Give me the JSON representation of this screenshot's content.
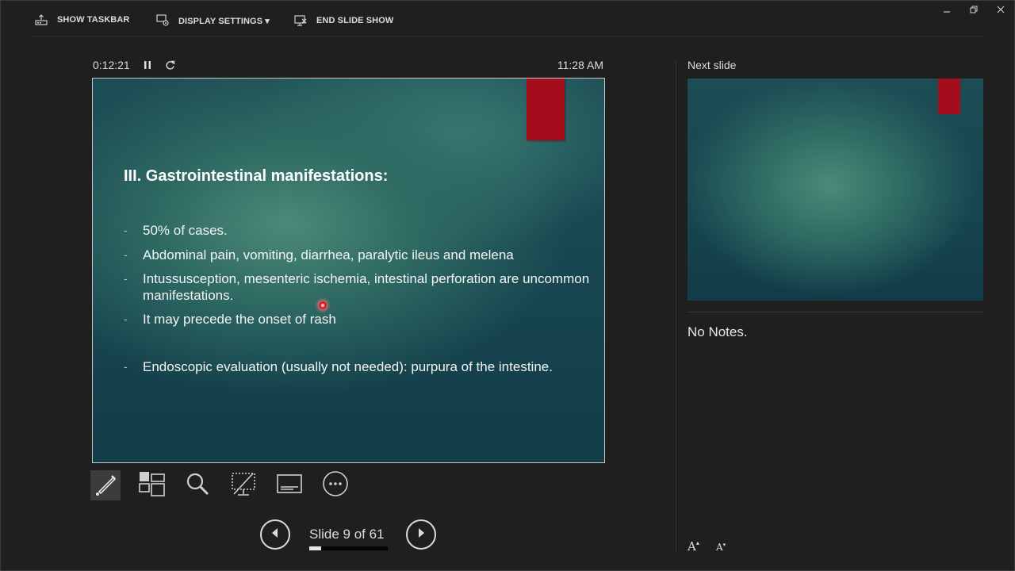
{
  "toolbar": {
    "show_taskbar": "SHOW TASKBAR",
    "display_settings": "DISPLAY SETTINGS ▾",
    "end_slide_show": "END SLIDE SHOW"
  },
  "window_controls": {
    "minimize_icon": "minimize-icon",
    "restore_icon": "restore-icon",
    "close_icon": "close-icon"
  },
  "timer": {
    "elapsed": "0:12:21"
  },
  "clock": "11:28 AM",
  "slide": {
    "title": "III. Gastrointestinal manifestations:",
    "bullets": [
      {
        "marker": "-",
        "text": "50% of cases."
      },
      {
        "marker": "-",
        "text": "Abdominal pain, vomiting, diarrhea, paralytic ileus and melena"
      },
      {
        "marker": "-",
        "text": "Intussusception, mesenteric ischemia, intestinal perforation are uncommon manifestations."
      },
      {
        "marker": "-",
        "text": "It may precede the onset of rash"
      },
      {
        "marker": "-",
        "text": "Endoscopic evaluation (usually not needed): purpura of the intestine."
      }
    ],
    "accent_color": "#a30d1c"
  },
  "navigation": {
    "counter": "Slide 9 of 61",
    "current": 9,
    "total": 61,
    "progress_fraction": 0.147
  },
  "next_slide": {
    "label": "Next slide"
  },
  "notes": {
    "text": "No Notes."
  },
  "font_controls": {
    "increase": "A",
    "decrease": "A"
  },
  "icons": {
    "pen": "pen-icon",
    "see_all_slides": "see-all-slides-icon",
    "zoom": "zoom-icon",
    "black_screen": "black-screen-icon",
    "subtitles": "subtitles-icon",
    "more": "more-options-icon"
  }
}
